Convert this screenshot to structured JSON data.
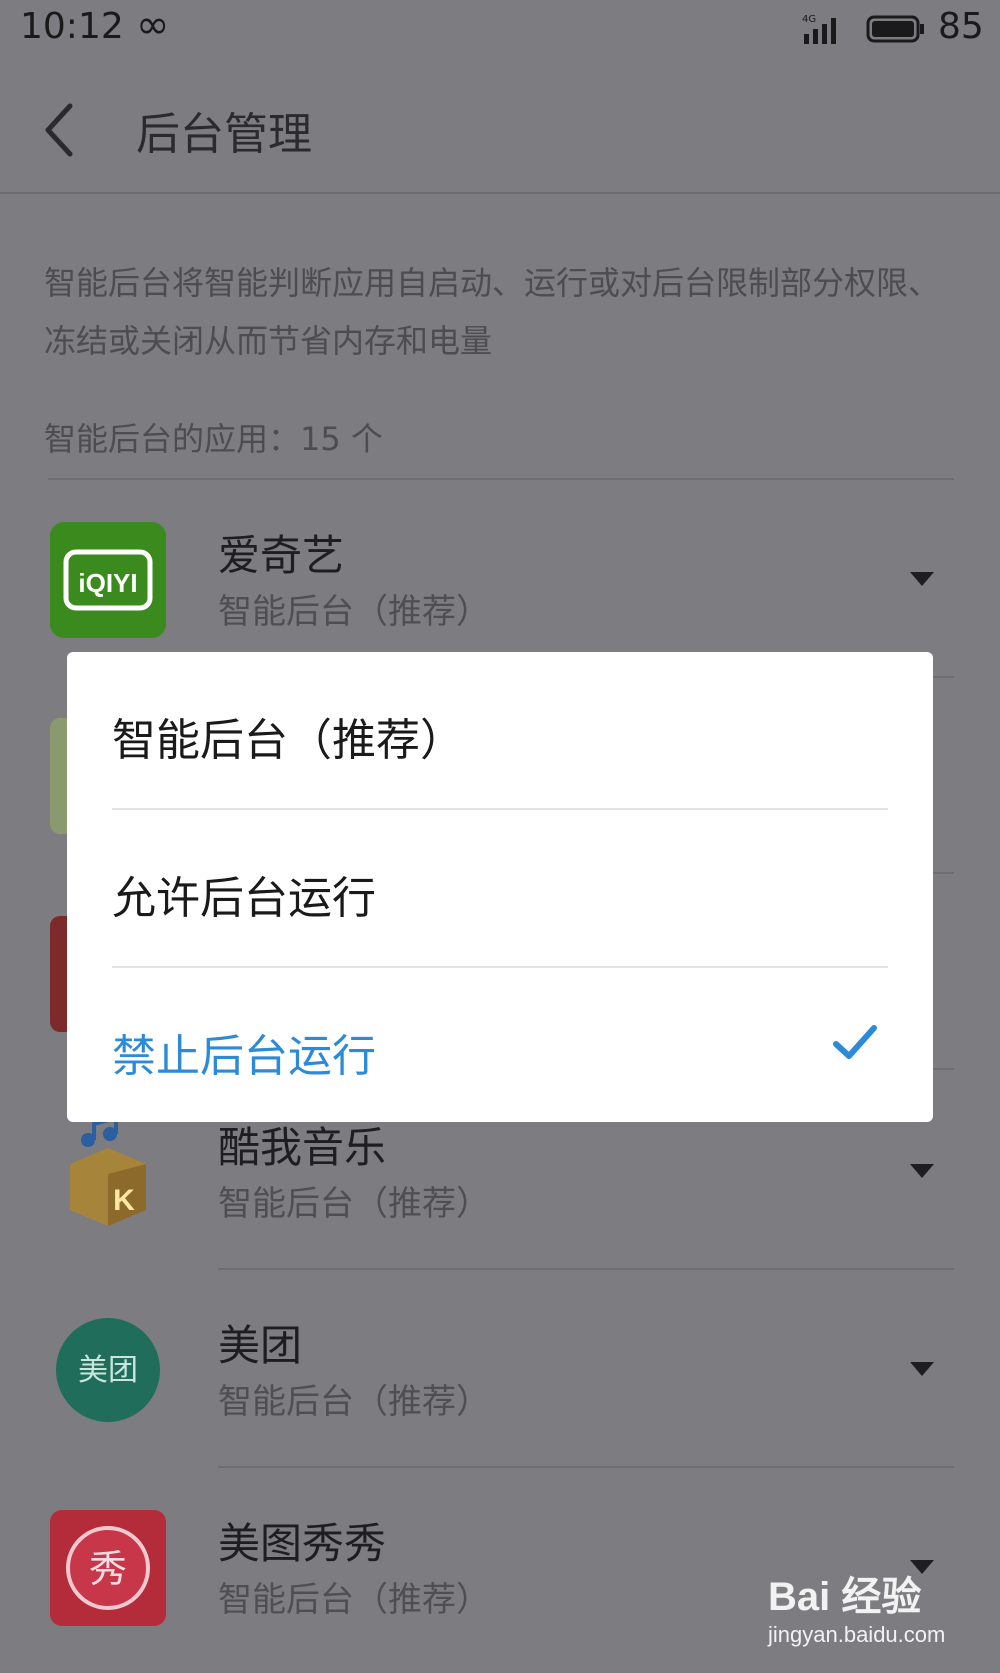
{
  "status_bar": {
    "time": "10:12",
    "battery": "85",
    "network": "4G"
  },
  "header": {
    "title": "后台管理"
  },
  "description": "智能后台将智能判断应用自启动、运行或对后台限制部分权限、冻结或关闭从而节省内存和电量",
  "count_label": "智能后台的应用：15 个",
  "apps": [
    {
      "name": "爱奇艺",
      "mode": "智能后台（推荐）",
      "icon": "iqiyi-icon",
      "icon_text": "iQIYI"
    },
    {
      "name": "酷我音乐",
      "mode": "智能后台（推荐）",
      "icon": "kuwo-music-icon"
    },
    {
      "name": "美团",
      "mode": "智能后台（推荐）",
      "icon": "meituan-icon",
      "icon_text": "美团"
    },
    {
      "name": "美图秀秀",
      "mode": "智能后台（推荐）",
      "icon": "meitu-icon",
      "icon_text": "秀"
    }
  ],
  "dialog": {
    "options": [
      {
        "label": "智能后台（推荐）",
        "selected": false
      },
      {
        "label": "允许后台运行",
        "selected": false
      },
      {
        "label": "禁止后台运行",
        "selected": true
      }
    ]
  },
  "watermark": {
    "main": "Bai 经验",
    "sub": "jingyan.baidu.com"
  },
  "colors": {
    "accent": "#2d8ad6",
    "overlay": "#7d7c80"
  }
}
